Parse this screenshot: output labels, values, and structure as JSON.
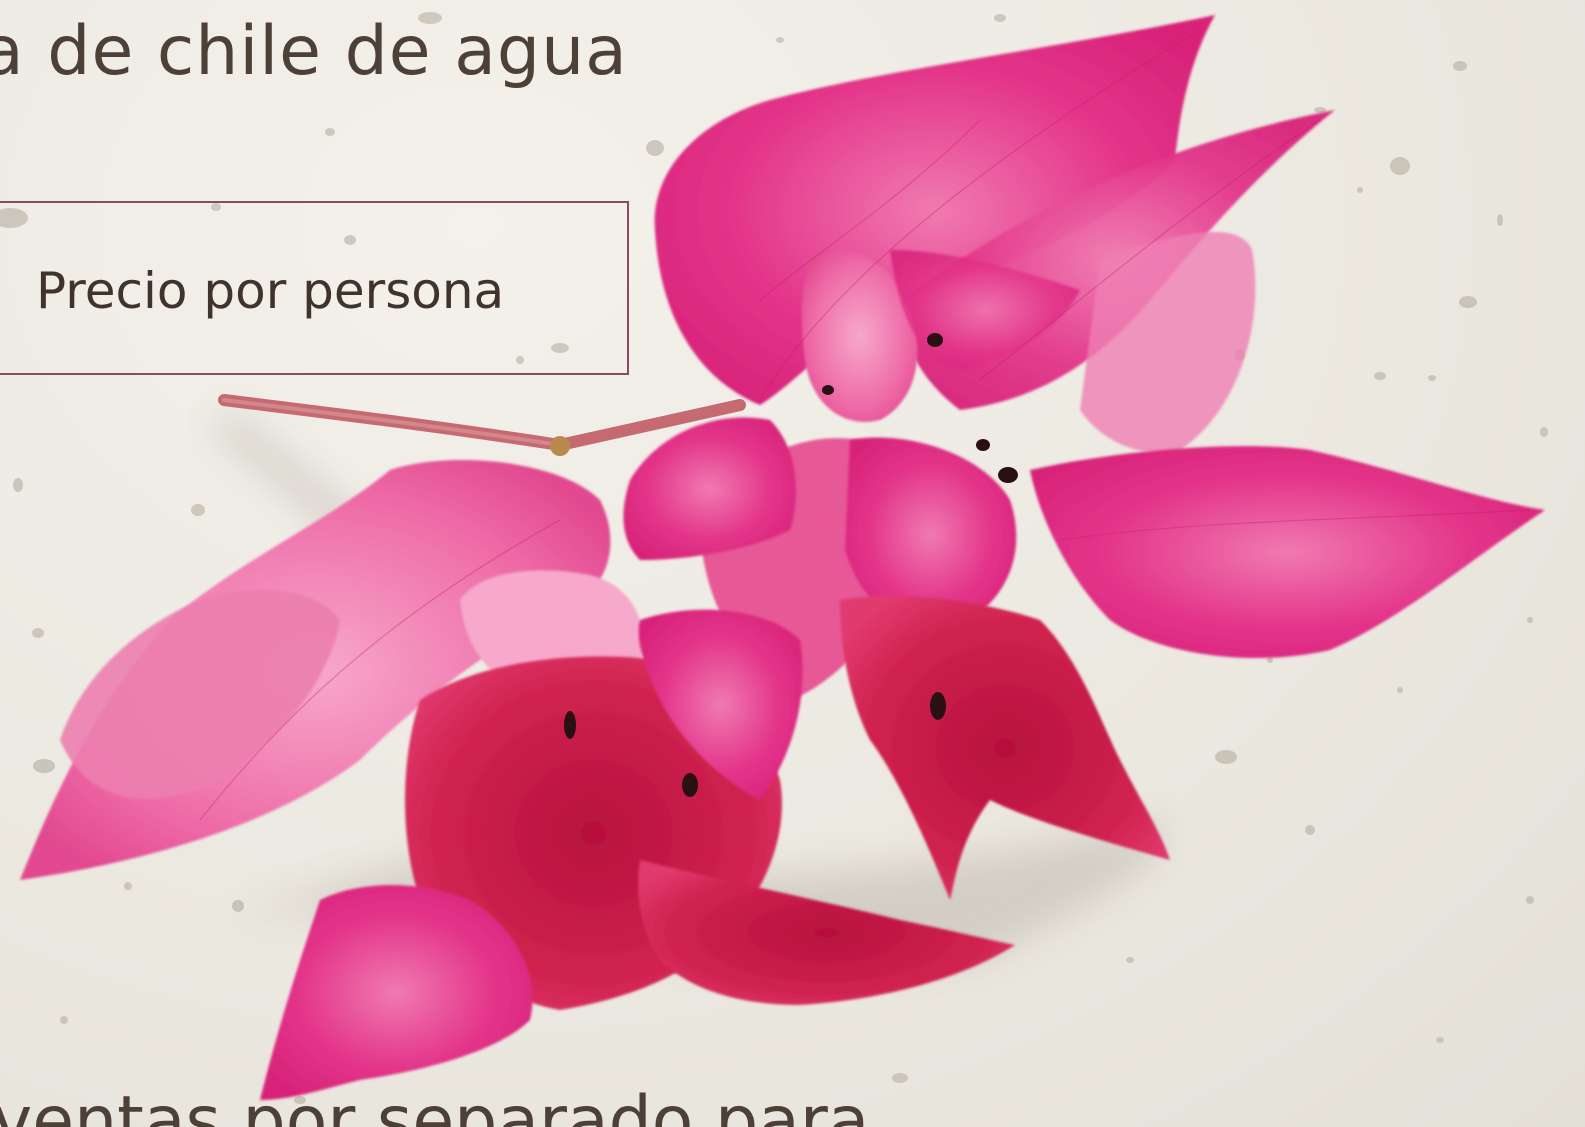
{
  "menu": {
    "title_fragment": "a de chile de agua",
    "price_fragment": ")",
    "price_label": "Precio por persona",
    "bottom_fragment": "ventas por separado para"
  },
  "colors": {
    "paper": "#ece9e1",
    "text": "#4a3d33",
    "box_border": "#8a4a66",
    "petal_main": "#e0307e",
    "petal_light": "#ee6aa6",
    "petal_dark": "#c21a4e"
  },
  "decor": {
    "flower_name": "bougainvillea-flower-image"
  }
}
